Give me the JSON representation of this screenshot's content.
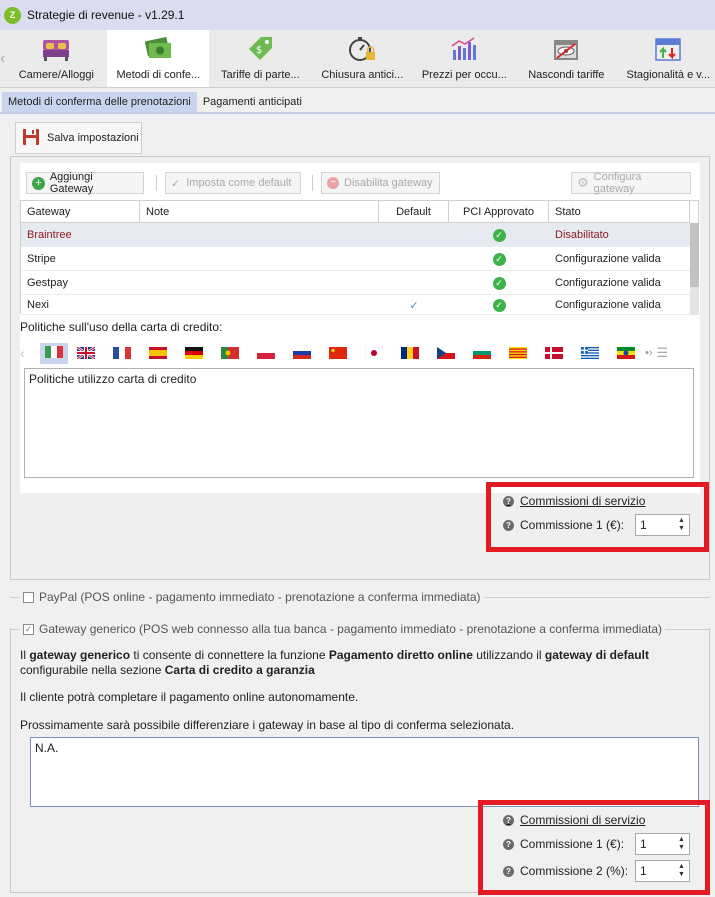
{
  "window": {
    "title": "Strategie di revenue - v1.29.1",
    "logo_text": "Z"
  },
  "ribbon": {
    "items": [
      {
        "label": "Camere/Alloggi",
        "icon": "bed-icon"
      },
      {
        "label": "Metodi di confe...",
        "icon": "money-icon",
        "active": true
      },
      {
        "label": "Tariffe di parte...",
        "icon": "price-tag-icon"
      },
      {
        "label": "Chiusura antici...",
        "icon": "stopwatch-lock-icon"
      },
      {
        "label": "Prezzi per occu...",
        "icon": "bar-chart-icon"
      },
      {
        "label": "Nascondi tariffe",
        "icon": "hidden-calendar-icon"
      },
      {
        "label": "Stagionalità e v...",
        "icon": "calendar-arrows-icon"
      }
    ]
  },
  "subtabs": [
    {
      "label": "Metodi di conferma delle prenotazioni",
      "active": true
    },
    {
      "label": "Pagamenti anticipati",
      "active": false
    }
  ],
  "save_button": "Salva impostazioni",
  "toolbar": {
    "add_gateway": "Aggiungi Gateway",
    "set_default": "Imposta come default",
    "disable_gateway": "Disabilita gateway",
    "configure_gateway": "Configura gateway"
  },
  "grid": {
    "columns": [
      "Gateway",
      "Note",
      "Default",
      "PCI Approvato",
      "Stato"
    ],
    "rows": [
      {
        "gateway": "Braintree",
        "note": "",
        "default": false,
        "pci": true,
        "status": "Disabilitato"
      },
      {
        "gateway": "Stripe",
        "note": "",
        "default": false,
        "pci": true,
        "status": "Configurazione valida"
      },
      {
        "gateway": "Gestpay",
        "note": "",
        "default": false,
        "pci": true,
        "status": "Configurazione valida"
      },
      {
        "gateway": "Nexi",
        "note": "",
        "default": true,
        "pci": true,
        "status": "Configurazione valida"
      }
    ]
  },
  "credit_card_policy": {
    "label": "Politiche sull'uso della carta di credito:",
    "text": "Politiche utilizzo carta di credito"
  },
  "fees1": {
    "title": "Commissioni di servizio",
    "fee1_label": "Commissione 1 (€):",
    "fee1_value": "1"
  },
  "paypal": {
    "label": "PayPal (POS online - pagamento immediato - prenotazione a conferma immediata)"
  },
  "generic_gateway": {
    "label": "Gateway generico (POS web connesso alla tua banca - pagamento immediato - prenotazione a conferma immediata)",
    "p1_a": "Il ",
    "p1_b": "gateway generico",
    "p1_c": " ti consente di connettere la funzione ",
    "p1_d": "Pagamento diretto online",
    "p1_e": " utilizzando il ",
    "p1_f": "gateway di default",
    "p1_g": " configurabile nella sezione ",
    "p1_h": "Carta di credito a garanzia",
    "p2": "Il cliente potrà completare il pagamento online autonomamente.",
    "p3": "Prossimamente sarà possibile differenziare i gateway in base al tipo di conferma selezionata.",
    "text": "N.A."
  },
  "fees2": {
    "title": "Commissioni di servizio",
    "fee1_label": "Commissione 1 (€):",
    "fee1_value": "1",
    "fee2_label": "Commissione 2 (%):",
    "fee2_value": "1"
  },
  "colors": {
    "highlight_box": "#e41b23",
    "active_tab": "#c9d4ee",
    "disabled_status": "#8b1a1a"
  }
}
